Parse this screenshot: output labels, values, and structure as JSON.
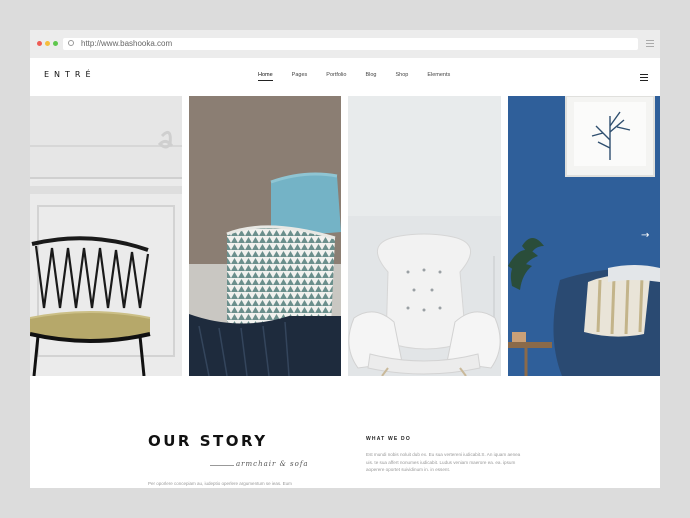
{
  "browser": {
    "url": "http://www.bashooka.com",
    "dot_colors": [
      "#ee5c55",
      "#f5bd3c",
      "#5ec74d"
    ]
  },
  "header": {
    "logo": "ENTRÉ",
    "nav": [
      "Home",
      "Pages",
      "Portfolio",
      "Blog",
      "Shop",
      "Elements"
    ],
    "active_nav": "Home"
  },
  "slider": {
    "next_icon": "arrow-right-icon",
    "panels": [
      {
        "subject": "black wire chair against white paneled wall"
      },
      {
        "subject": "patterned pillow and blue pillow with knit throw"
      },
      {
        "subject": "white tufted wingback armchair"
      },
      {
        "subject": "navy sofa with striped pillows under tree artwork"
      }
    ]
  },
  "story": {
    "title": "OUR STORY",
    "subtitle": "armchair & sofa",
    "body": "Per oporlere concepiam au, iudeptio operlere argumentum se ieas. Eum"
  },
  "what_we_do": {
    "title": "WHAT WE DO",
    "lines": [
      "Est mundi nobis noluit dub ex. Eu sua vertereni iudicabit.S. An iquam aenea",
      "uis. te sua affert nonumes iudicabit. Ludus veniam maerore ea. ea. ipsum",
      "aoperere oportet suividinum in. in essent."
    ]
  }
}
